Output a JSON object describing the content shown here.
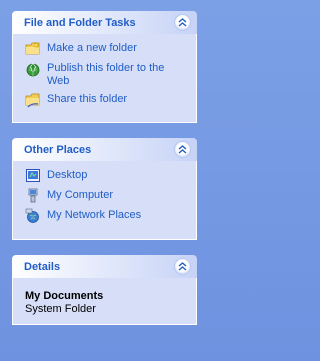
{
  "panels": {
    "tasks": {
      "title": "File and Folder Tasks",
      "items": [
        {
          "label": "Make a new folder",
          "icon": "new-folder-icon"
        },
        {
          "label": "Publish this folder to the Web",
          "icon": "publish-web-icon"
        },
        {
          "label": "Share this folder",
          "icon": "share-folder-icon"
        }
      ]
    },
    "places": {
      "title": "Other Places",
      "items": [
        {
          "label": "Desktop",
          "icon": "desktop-icon"
        },
        {
          "label": "My Computer",
          "icon": "my-computer-icon"
        },
        {
          "label": "My Network Places",
          "icon": "network-places-icon"
        }
      ]
    },
    "details": {
      "title": "Details",
      "name": "My Documents",
      "type": "System Folder"
    }
  },
  "colors": {
    "background": "#7b9ce3",
    "header_text": "#215dc6",
    "panel_body": "#d6dff7"
  }
}
